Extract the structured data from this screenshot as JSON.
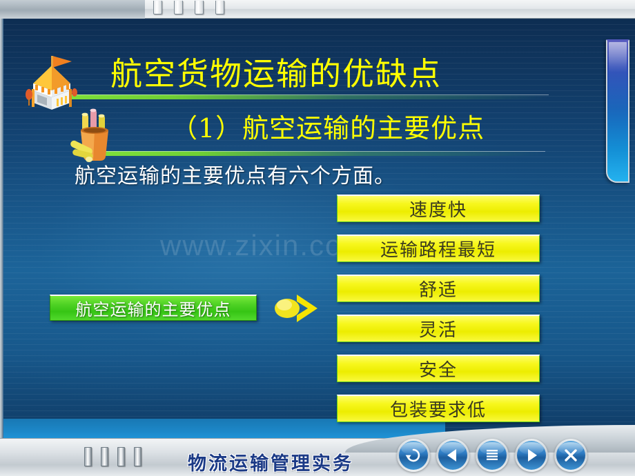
{
  "slide": {
    "title": "航空货物运输的优缺点",
    "subtitle": "（1）航空运输的主要优点",
    "body_line": "航空运输的主要优点有六个方面。",
    "watermark": "www.zixin.com.cn",
    "source_box_label": "航空运输的主要优点"
  },
  "advantages": [
    {
      "label": "速度快"
    },
    {
      "label": "运输路程最短"
    },
    {
      "label": "舒适"
    },
    {
      "label": "灵活"
    },
    {
      "label": "安全"
    },
    {
      "label": "包装要求低"
    }
  ],
  "footer": {
    "brand": "物流运输管理实务",
    "nav": [
      {
        "name": "undo-button",
        "icon": "undo-icon"
      },
      {
        "name": "previous-button",
        "icon": "triangle-left-icon"
      },
      {
        "name": "menu-button",
        "icon": "menu-lines-icon"
      },
      {
        "name": "next-button",
        "icon": "triangle-right-icon"
      },
      {
        "name": "close-button",
        "icon": "close-x-icon"
      }
    ]
  },
  "colors": {
    "title_yellow": "#FFFF00",
    "box_yellow": "#EDED00",
    "box_green": "#36C515",
    "background_blue": "#1B6398",
    "brand_blue": "#1B3A86",
    "accent_green": "#7EE03A"
  },
  "top_tabs_count": 4,
  "footer_ticks_count": 4
}
